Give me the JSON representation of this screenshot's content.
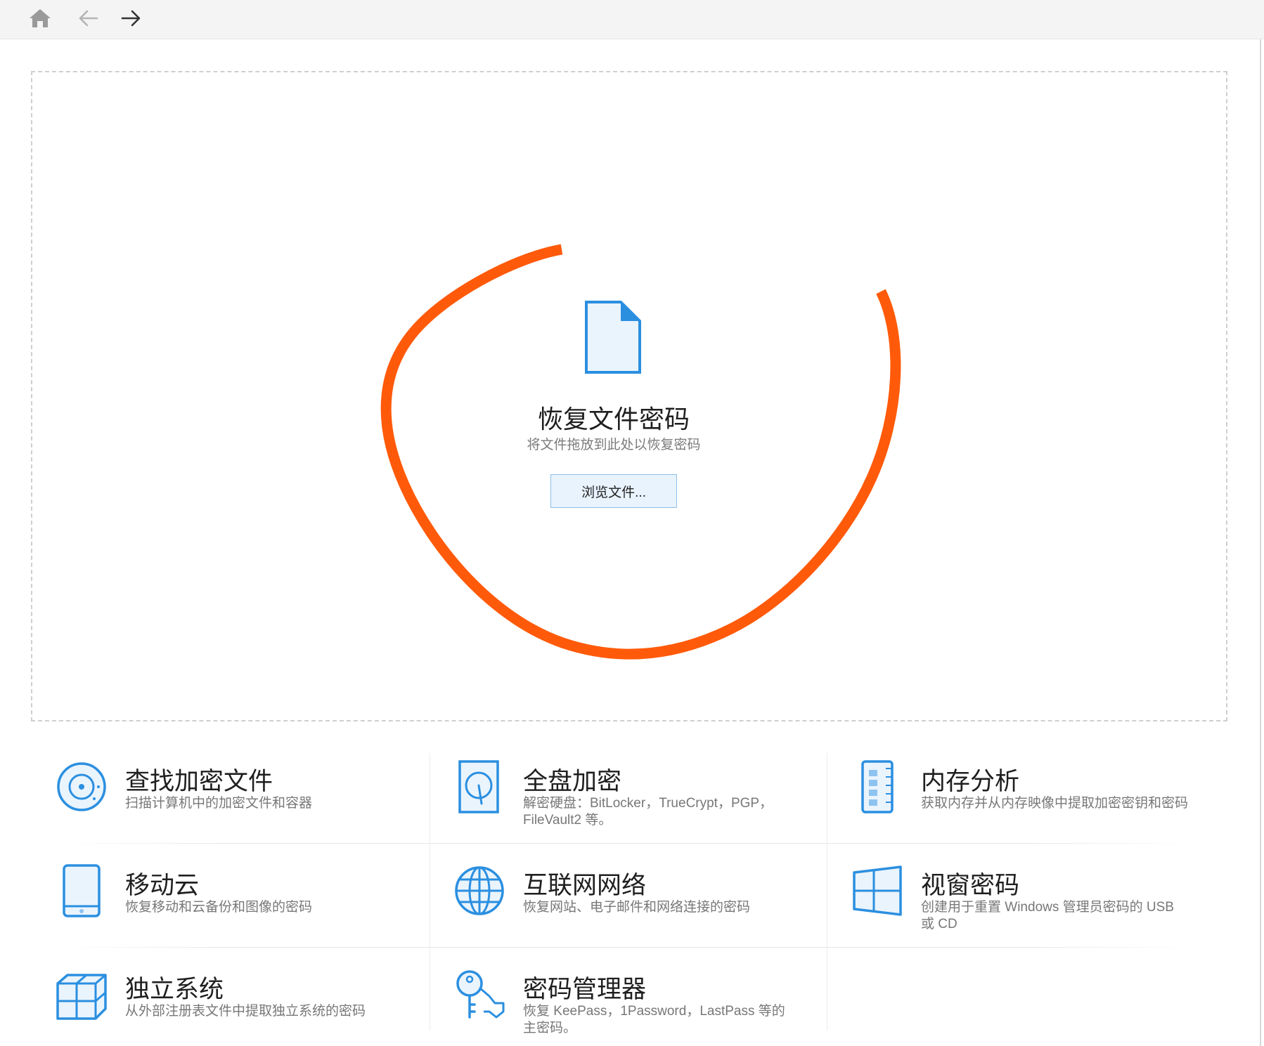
{
  "toolbar": {
    "home_icon": "home-icon",
    "back_icon": "arrow-left-icon",
    "forward_icon": "arrow-right-icon"
  },
  "dropzone": {
    "title": "恢复文件密码",
    "subtitle": "将文件拖放到此处以恢复密码",
    "browse_label": "浏览文件..."
  },
  "features": [
    {
      "icon": "disk-scan-icon",
      "title": "查找加密文件",
      "desc": "扫描计算机中的加密文件和容器"
    },
    {
      "icon": "hard-drive-icon",
      "title": "全盘加密",
      "desc": "解密硬盘：BitLocker，TrueCrypt，PGP，FileVault2 等。"
    },
    {
      "icon": "memory-chip-icon",
      "title": "内存分析",
      "desc": "获取内存并从内存映像中提取加密密钥和密码"
    },
    {
      "icon": "tablet-icon",
      "title": "移动云",
      "desc": "恢复移动和云备份和图像的密码"
    },
    {
      "icon": "globe-icon",
      "title": "互联网网络",
      "desc": "恢复网站、电子邮件和网络连接的密码"
    },
    {
      "icon": "windows-icon",
      "title": "视窗密码",
      "desc": "创建用于重置 Windows 管理员密码的 USB 或 CD"
    },
    {
      "icon": "cubes-icon",
      "title": "独立系统",
      "desc": "从外部注册表文件中提取独立系统的密码"
    },
    {
      "icon": "keys-icon",
      "title": "密码管理器",
      "desc": "恢复 KeePass，1Password，LastPass 等的主密码。"
    }
  ],
  "colors": {
    "accent": "#2b8fe0",
    "annotation": "#ff5a0a",
    "button_bg": "#e8f3fd"
  }
}
